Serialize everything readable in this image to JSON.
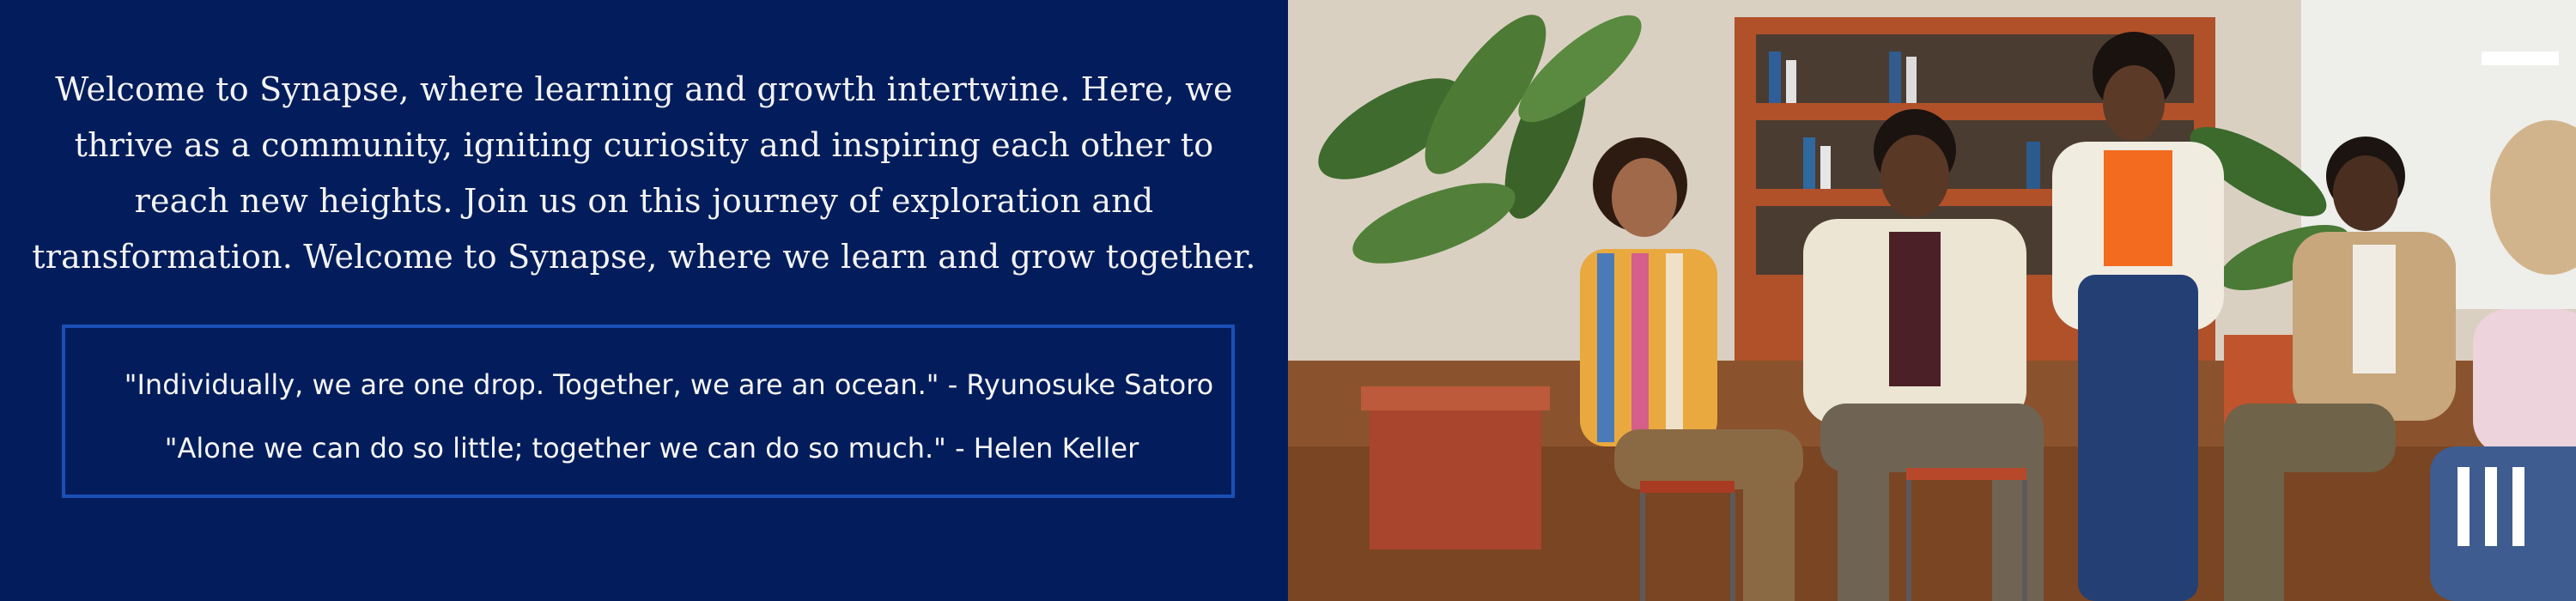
{
  "intro": {
    "text": "Welcome to Synapse, where learning and growth intertwine. Here, we thrive as a community, igniting curiosity and inspiring each other to reach new heights. Join us on this journey of exploration and transformation. Welcome to Synapse, where we learn and grow together."
  },
  "quotes": [
    {
      "text": "\"Individually, we are one drop. Together, we are an ocean.\" - Ryunosuke Satoro"
    },
    {
      "text": "\"Alone we can do so little; together we can do so much.\" - Helen Keller"
    }
  ],
  "colors": {
    "background": "#031d5c",
    "quote_border": "#1a4fb6",
    "text": "#f3f3f3"
  },
  "photo": {
    "icon": "group-discussion-photo"
  },
  "logo": {
    "icon": "three-bars-logo-icon"
  }
}
